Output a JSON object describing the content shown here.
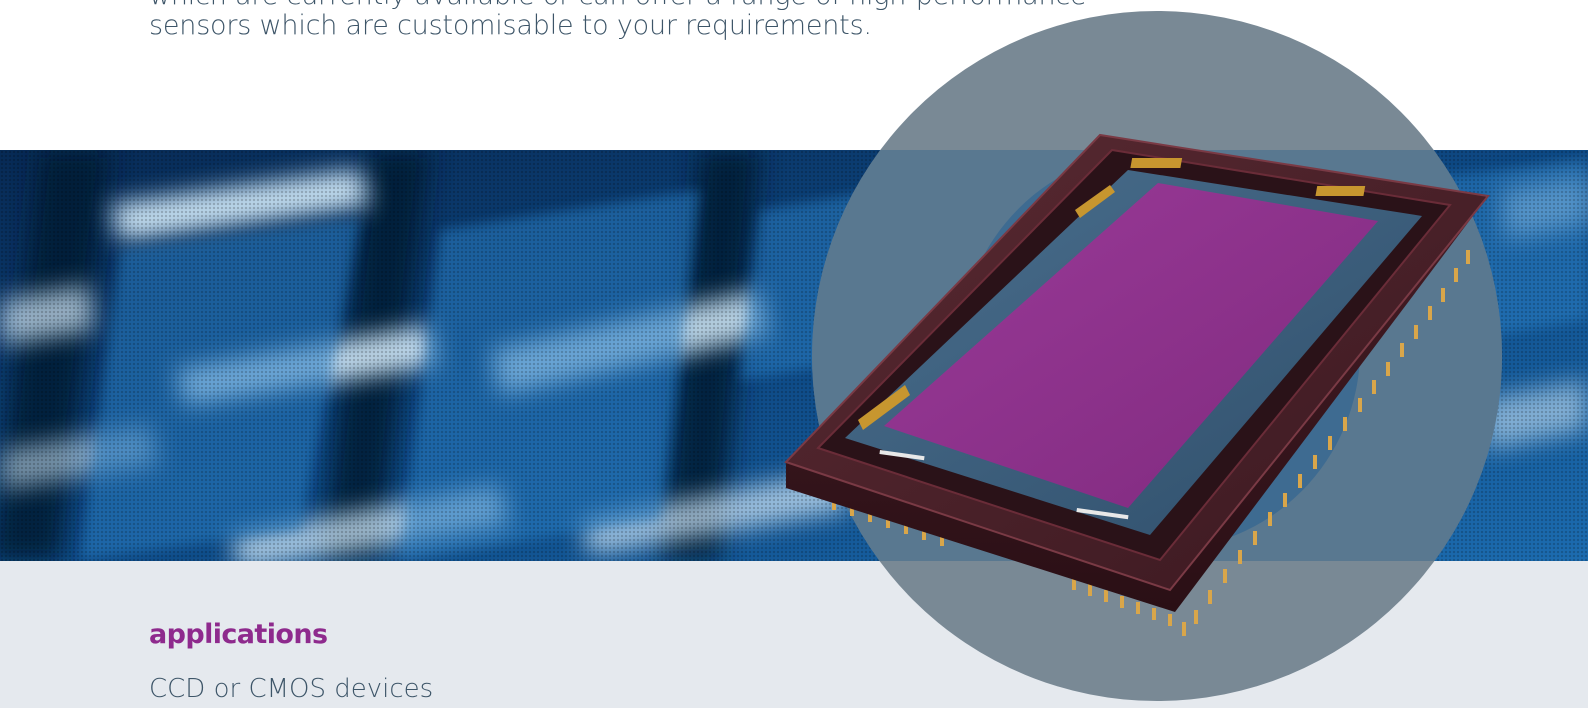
{
  "intro": {
    "line_1": "which are currently available or can offer a range of high-performance",
    "line_2": "sensors which are customisable to your requirements."
  },
  "applications": {
    "heading": "applications",
    "first_item": "CCD or CMOS devices"
  },
  "colors": {
    "heading_purple": "#8e2a8d",
    "body_text": "#3d5568",
    "band_grey": "#e5e9ee",
    "circle_slate": "#7a8a95",
    "banner_blue": "#0b3a6e",
    "sensor_magenta": "#8b3189"
  },
  "images": {
    "hero_banner": "blurred-blue-sensor-grid-photo",
    "product": "ccd-sensor-chip-photo"
  }
}
